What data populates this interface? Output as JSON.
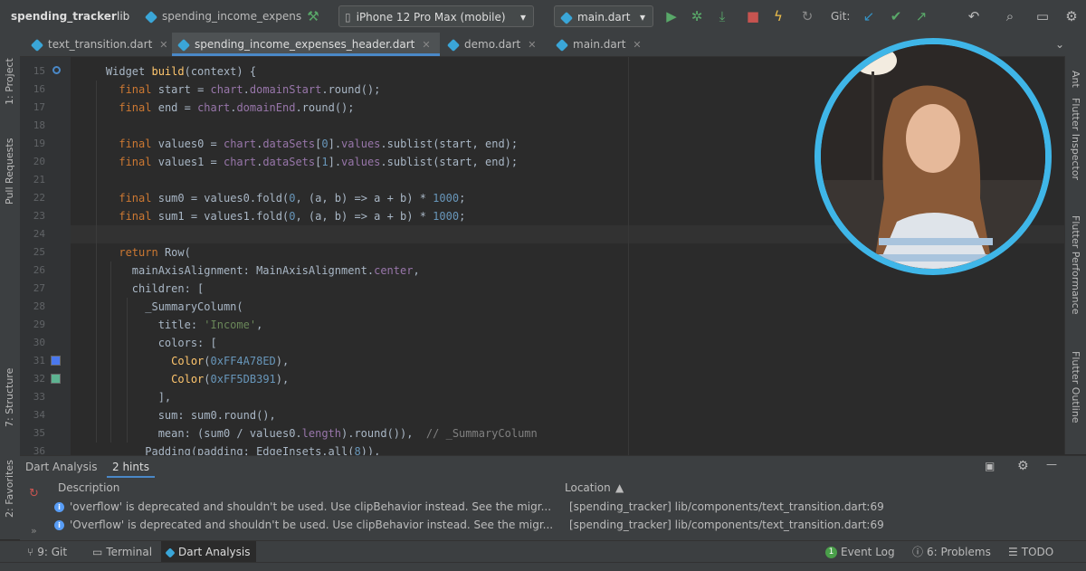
{
  "toolbar": {
    "project": "spending_tracker",
    "folder": "lib",
    "file_crumb": "spending_income_expens",
    "device": "iPhone 12 Pro Max (mobile)",
    "run_config": "main.dart",
    "git_label": "Git:"
  },
  "tabs": [
    {
      "label": "text_transition.dart",
      "active": false
    },
    {
      "label": "spending_income_expenses_header.dart",
      "active": true
    },
    {
      "label": "demo.dart",
      "active": false
    },
    {
      "label": "main.dart",
      "active": false
    }
  ],
  "left_tools": [
    "1: Project",
    "Pull Requests",
    "7: Structure",
    "2: Favorites"
  ],
  "right_tools": [
    "Ant",
    "Flutter Inspector",
    "Flutter Performance",
    "Flutter Outline"
  ],
  "editor": {
    "caret_line": 24,
    "lines": [
      {
        "n": "15",
        "html": "<span class=\"cls\">Widget </span><span class=\"fn\">build</span>(context) {"
      },
      {
        "n": "16",
        "html": "  <span class=\"kw\">final </span>start = <span class=\"prop\">chart</span>.<span class=\"prop\">domainStart</span>.round();"
      },
      {
        "n": "17",
        "html": "  <span class=\"kw\">final </span>end = <span class=\"prop\">chart</span>.<span class=\"prop\">domainEnd</span>.round();"
      },
      {
        "n": "18",
        "html": ""
      },
      {
        "n": "19",
        "html": "  <span class=\"kw\">final </span>values0 = <span class=\"prop\">chart</span>.<span class=\"prop\">dataSets</span>[<span class=\"num\">0</span>].<span class=\"prop\">values</span>.sublist(start, end);"
      },
      {
        "n": "20",
        "html": "  <span class=\"kw\">final </span>values1 = <span class=\"prop\">chart</span>.<span class=\"prop\">dataSets</span>[<span class=\"num\">1</span>].<span class=\"prop\">values</span>.sublist(start, end);"
      },
      {
        "n": "21",
        "html": ""
      },
      {
        "n": "22",
        "html": "  <span class=\"kw\">final </span>sum0 = values0.fold(<span class=\"num\">0</span>, (a, b) => a + b) * <span class=\"num\">1000</span>;"
      },
      {
        "n": "23",
        "html": "  <span class=\"kw\">final </span>sum1 = values1.fold(<span class=\"num\">0</span>, (a, b) => a + b) * <span class=\"num\">1000</span>;"
      },
      {
        "n": "24",
        "html": ""
      },
      {
        "n": "25",
        "html": "  <span class=\"kw\">return </span>Row("
      },
      {
        "n": "26",
        "html": "    mainAxisAlignment: MainAxisAlignment.<span class=\"prop\">center</span>,"
      },
      {
        "n": "27",
        "html": "    children: ["
      },
      {
        "n": "28",
        "html": "      _SummaryColumn("
      },
      {
        "n": "29",
        "html": "        title: <span class=\"str\">'Income'</span>,"
      },
      {
        "n": "30",
        "html": "        colors: ["
      },
      {
        "n": "31",
        "html": "          <span class=\"fn\">Color</span>(<span class=\"num\">0xFF4A78ED</span>),"
      },
      {
        "n": "32",
        "html": "          <span class=\"fn\">Color</span>(<span class=\"num\">0xFF5DB391</span>),"
      },
      {
        "n": "33",
        "html": "        ],"
      },
      {
        "n": "34",
        "html": "        sum: sum0.round(),"
      },
      {
        "n": "35",
        "html": "        mean: (sum0 / values0.<span class=\"prop\">length</span>).round()),  <span class=\"cmt\">// _SummaryColumn</span>"
      },
      {
        "n": "36",
        "html": "      Padding(padding: EdgeInsets.all(<span class=\"num\">8</span>)),"
      }
    ],
    "swatches": [
      {
        "line": "31",
        "color": "#4A78ED"
      },
      {
        "line": "32",
        "color": "#5DB391"
      }
    ]
  },
  "panel": {
    "title": "Dart Analysis",
    "hint_count": "2 hints",
    "col_description": "Description",
    "col_location": "Location",
    "hints": [
      {
        "description": "'overflow' is deprecated and shouldn't be used. Use clipBehavior instead. See the migr...",
        "location": "[spending_tracker] lib/components/text_transition.dart:69"
      },
      {
        "description": "'Overflow' is deprecated and shouldn't be used. Use clipBehavior instead. See the migr...",
        "location": "[spending_tracker] lib/components/text_transition.dart:69"
      }
    ]
  },
  "bottom_tools": {
    "git": "9: Git",
    "terminal": "Terminal",
    "dart_analysis": "Dart Analysis",
    "event_log": "Event Log",
    "event_log_count": "1",
    "problems": "6: Problems",
    "todo": "TODO"
  }
}
